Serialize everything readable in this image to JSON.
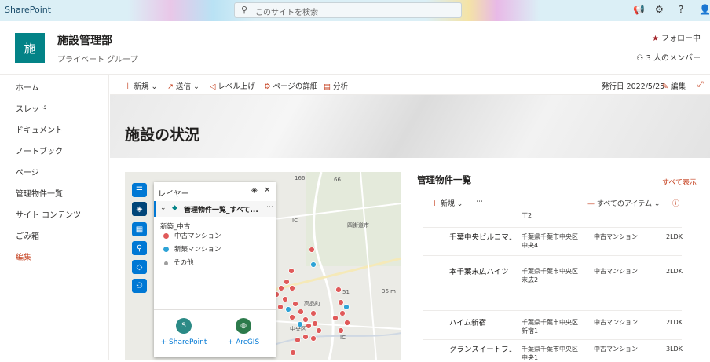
{
  "suite": {
    "brand": "SharePoint",
    "search_placeholder": "このサイトを検索",
    "search_icon": "search-icon"
  },
  "site": {
    "logo_text": "施",
    "title": "施設管理部",
    "subtitle": "プライベート グループ",
    "follow_label": "フォロー中",
    "members_label": "3 人のメンバー",
    "colors": {
      "logo": "#038387",
      "accent": "#c43e1c",
      "link": "#0078d4"
    }
  },
  "nav": {
    "items": [
      "ホーム",
      "スレッド",
      "ドキュメント",
      "ノートブック",
      "ページ",
      "管理物件一覧",
      "サイト コンテンツ",
      "ごみ箱",
      "編集"
    ]
  },
  "command_bar": {
    "new": "新規",
    "send": "送信",
    "promote": "レベル上げ",
    "page_details": "ページの詳細",
    "analytics": "分析",
    "published": "発行日 2022/5/25",
    "edit": "編集"
  },
  "page": {
    "title": "施設の状況"
  },
  "map": {
    "layer_panel": {
      "title": "レイヤー",
      "layer_name": "管理物件一覧_すべて...",
      "group": "新築_中古",
      "legend": [
        {
          "label": "中古マンション",
          "color": "#e05a5a"
        },
        {
          "label": "新築マンション",
          "color": "#2ea3d6"
        },
        {
          "label": "その他",
          "color": "#9e9e9e"
        }
      ],
      "add_sharepoint": "+ SharePoint",
      "add_arcgis": "+ ArcGIS"
    },
    "labels": {
      "road_166": "166",
      "road_66": "66",
      "town": "四街道市",
      "station": "高品町",
      "ward": "中央区",
      "ic1": "IC",
      "ic2": "IC",
      "dist": "36 m",
      "road_51": "51"
    }
  },
  "list": {
    "title": "管理物件一覧",
    "see_all": "すべて表示",
    "new": "新規",
    "view": "すべてのアイテム",
    "rows": [
      {
        "name": "",
        "address": "丁2",
        "type": "",
        "plan": ""
      },
      {
        "name": "千葉中央ビルコマ...",
        "address": "千葉県千葉市中央区中央4",
        "type": "中古マンション",
        "plan": "2LDK"
      },
      {
        "name": "本千葉末広ハイツ",
        "address": "千葉県千葉市中央区末広2",
        "type": "中古マンション",
        "plan": "2LDK"
      },
      {
        "name": "ハイム新宿",
        "address": "千葉県千葉市中央区新宿1",
        "type": "中古マンション",
        "plan": "2LDK"
      },
      {
        "name": "グランスイートブ...",
        "address": "千葉県千葉市中央区中央1",
        "type": "中古マンション",
        "plan": "3LDK"
      }
    ]
  }
}
